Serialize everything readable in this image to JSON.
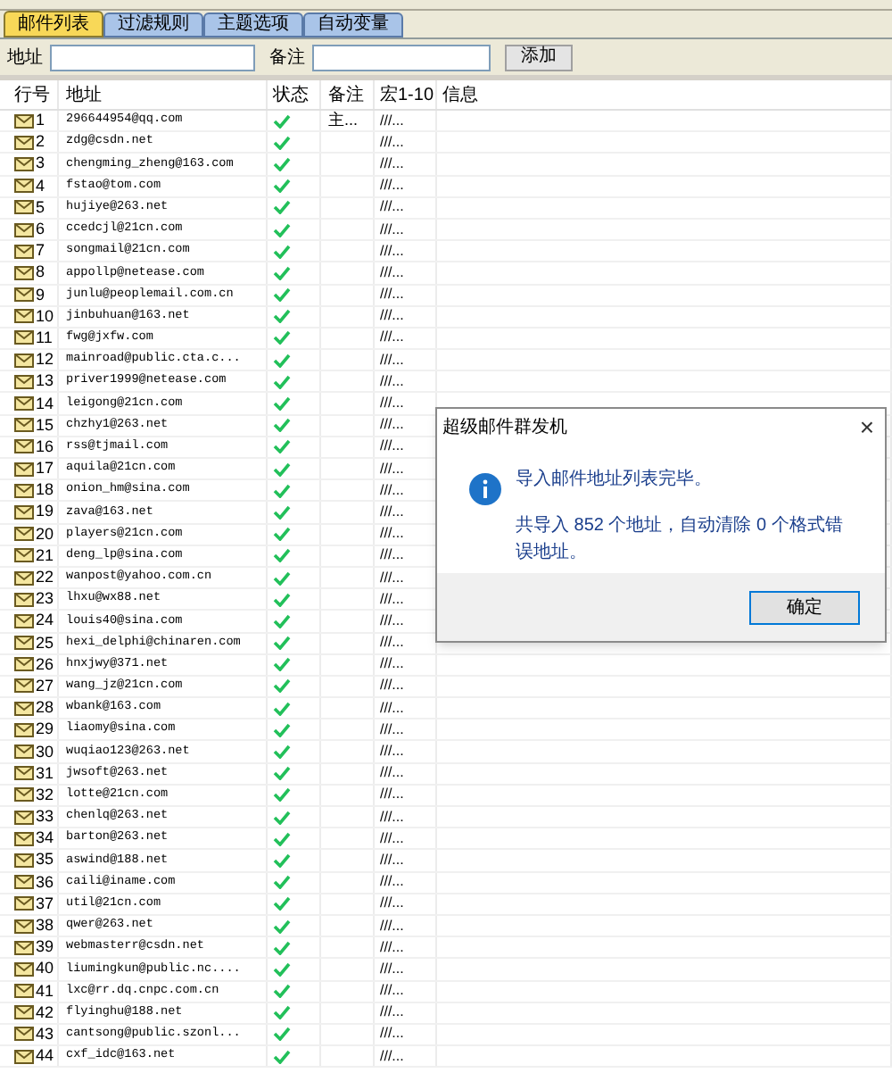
{
  "tabs": [
    {
      "label": "邮件列表",
      "selected": true
    },
    {
      "label": "过滤规则",
      "selected": false
    },
    {
      "label": "主题选项",
      "selected": false
    },
    {
      "label": "自动变量",
      "selected": false
    }
  ],
  "form": {
    "address_label": "地址",
    "note_label": "备注",
    "add_button": "添加"
  },
  "table": {
    "columns": [
      "行号",
      "地址",
      "状态",
      "备注",
      "宏1-10",
      "信息"
    ],
    "rows": [
      {
        "num": "1",
        "address": "296644954@qq.com",
        "valid": true,
        "note": "主...",
        "macro": "///..."
      },
      {
        "num": "2",
        "address": "zdg@csdn.net",
        "valid": true,
        "macro": "///..."
      },
      {
        "num": "3",
        "address": "chengming_zheng@163.com",
        "valid": true,
        "macro": "///..."
      },
      {
        "num": "4",
        "address": "fstao@tom.com",
        "valid": true,
        "macro": "///..."
      },
      {
        "num": "5",
        "address": "hujiye@263.net",
        "valid": true,
        "macro": "///..."
      },
      {
        "num": "6",
        "address": "ccedcjl@21cn.com",
        "valid": true,
        "macro": "///..."
      },
      {
        "num": "7",
        "address": "songmail@21cn.com",
        "valid": true,
        "macro": "///..."
      },
      {
        "num": "8",
        "address": "appollp@netease.com",
        "valid": true,
        "macro": "///..."
      },
      {
        "num": "9",
        "address": "junlu@peoplemail.com.cn",
        "valid": true,
        "macro": "///..."
      },
      {
        "num": "10",
        "address": "jinbuhuan@163.net",
        "valid": true,
        "macro": "///..."
      },
      {
        "num": "11",
        "address": "fwg@jxfw.com",
        "valid": true,
        "macro": "///..."
      },
      {
        "num": "12",
        "address": "mainroad@public.cta.c...",
        "valid": true,
        "macro": "///..."
      },
      {
        "num": "13",
        "address": "priver1999@netease.com",
        "valid": true,
        "macro": "///..."
      },
      {
        "num": "14",
        "address": "leigong@21cn.com",
        "valid": true,
        "macro": "///..."
      },
      {
        "num": "15",
        "address": "chzhy1@263.net",
        "valid": true,
        "macro": "///..."
      },
      {
        "num": "16",
        "address": "rss@tjmail.com",
        "valid": true,
        "macro": "///..."
      },
      {
        "num": "17",
        "address": "aquila@21cn.com",
        "valid": true,
        "macro": "///..."
      },
      {
        "num": "18",
        "address": "onion_hm@sina.com",
        "valid": true,
        "macro": "///..."
      },
      {
        "num": "19",
        "address": "zava@163.net",
        "valid": true,
        "macro": "///..."
      },
      {
        "num": "20",
        "address": "players@21cn.com",
        "valid": true,
        "macro": "///..."
      },
      {
        "num": "21",
        "address": "deng_lp@sina.com",
        "valid": true,
        "macro": "///..."
      },
      {
        "num": "22",
        "address": "wanpost@yahoo.com.cn",
        "valid": true,
        "macro": "///..."
      },
      {
        "num": "23",
        "address": "lhxu@wx88.net",
        "valid": true,
        "macro": "///..."
      },
      {
        "num": "24",
        "address": "louis40@sina.com",
        "valid": true,
        "macro": "///..."
      },
      {
        "num": "25",
        "address": "hexi_delphi@chinaren.com",
        "valid": true,
        "macro": "///..."
      },
      {
        "num": "26",
        "address": "hnxjwy@371.net",
        "valid": true,
        "macro": "///..."
      },
      {
        "num": "27",
        "address": "wang_jz@21cn.com",
        "valid": true,
        "macro": "///..."
      },
      {
        "num": "28",
        "address": "wbank@163.com",
        "valid": true,
        "macro": "///..."
      },
      {
        "num": "29",
        "address": "liaomy@sina.com",
        "valid": true,
        "macro": "///..."
      },
      {
        "num": "30",
        "address": "wuqiao123@263.net",
        "valid": true,
        "macro": "///..."
      },
      {
        "num": "31",
        "address": "jwsoft@263.net",
        "valid": true,
        "macro": "///..."
      },
      {
        "num": "32",
        "address": "lotte@21cn.com",
        "valid": true,
        "macro": "///..."
      },
      {
        "num": "33",
        "address": "chenlq@263.net",
        "valid": true,
        "macro": "///..."
      },
      {
        "num": "34",
        "address": "barton@263.net",
        "valid": true,
        "macro": "///..."
      },
      {
        "num": "35",
        "address": "aswind@188.net",
        "valid": true,
        "macro": "///..."
      },
      {
        "num": "36",
        "address": "caili@iname.com",
        "valid": true,
        "macro": "///..."
      },
      {
        "num": "37",
        "address": "util@21cn.com",
        "valid": true,
        "macro": "///..."
      },
      {
        "num": "38",
        "address": "qwer@263.net",
        "valid": true,
        "macro": "///..."
      },
      {
        "num": "39",
        "address": "webmasterr@csdn.net",
        "valid": true,
        "macro": "///..."
      },
      {
        "num": "40",
        "address": "liumingkun@public.nc....",
        "valid": true,
        "macro": "///..."
      },
      {
        "num": "41",
        "address": "lxc@rr.dq.cnpc.com.cn",
        "valid": true,
        "macro": "///..."
      },
      {
        "num": "42",
        "address": "flyinghu@188.net",
        "valid": true,
        "macro": "///..."
      },
      {
        "num": "43",
        "address": "cantsong@public.szonl...",
        "valid": true,
        "macro": "///..."
      },
      {
        "num": "44",
        "address": "cxf_idc@163.net",
        "valid": true,
        "macro": "///..."
      }
    ]
  },
  "dialog": {
    "title": "超级邮件群发机",
    "close": "×",
    "message": "导入邮件地址列表完毕。",
    "detail": "共导入 852 个地址，自动清除 0 个格式错误地址。",
    "ok_button": "确定"
  }
}
